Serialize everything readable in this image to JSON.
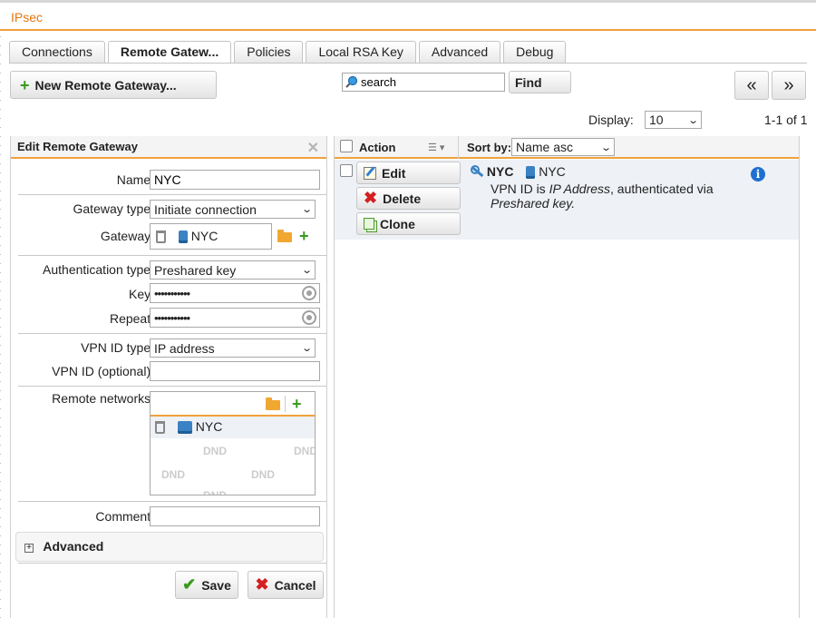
{
  "app": {
    "title": "IPsec"
  },
  "tabs": [
    {
      "label": "Connections"
    },
    {
      "label": "Remote Gatew..."
    },
    {
      "label": "Policies"
    },
    {
      "label": "Local RSA Key"
    },
    {
      "label": "Advanced"
    },
    {
      "label": "Debug"
    }
  ],
  "toolbar": {
    "new_button": "New Remote Gateway...",
    "search_value": "search",
    "find_button": "Find",
    "prev_button": "«",
    "next_button": "»",
    "display_label": "Display:",
    "display_value": "10",
    "range_text": "1-1 of 1"
  },
  "form": {
    "header": "Edit Remote Gateway",
    "name_label": "Name:",
    "name_value": "NYC",
    "gateway_type_label": "Gateway type:",
    "gateway_type_value": "Initiate connection",
    "gateway_label": "Gateway:",
    "gateway_value": "NYC",
    "auth_type_label": "Authentication type:",
    "auth_type_value": "Preshared key",
    "key_label": "Key:",
    "key_value": "•••••••••••",
    "repeat_label": "Repeat:",
    "repeat_value": "•••••••••••",
    "vpn_id_type_label": "VPN ID type:",
    "vpn_id_type_value": "IP address",
    "vpn_id_label": "VPN ID (optional):",
    "vpn_id_value": "",
    "remote_networks_label": "Remote networks:",
    "remote_network_item": "NYC",
    "dnd_text": "DND",
    "comment_label": "Comment:",
    "comment_value": "",
    "advanced_label": "Advanced",
    "save_button": "Save",
    "cancel_button": "Cancel"
  },
  "list": {
    "action_header": "Action",
    "sort_label": "Sort by:",
    "sort_value": "Name asc",
    "edit_button": "Edit",
    "delete_button": "Delete",
    "clone_button": "Clone",
    "row": {
      "name": "NYC",
      "gateway": "NYC",
      "desc_prefix": "VPN ID is ",
      "desc_id": "IP Address",
      "desc_mid": ", authenticated via",
      "desc_auth": "Preshared key",
      "desc_end": "."
    }
  },
  "colors": {
    "accent": "#f0a23c",
    "title": "#e6770d",
    "info": "#1f6fd0"
  }
}
